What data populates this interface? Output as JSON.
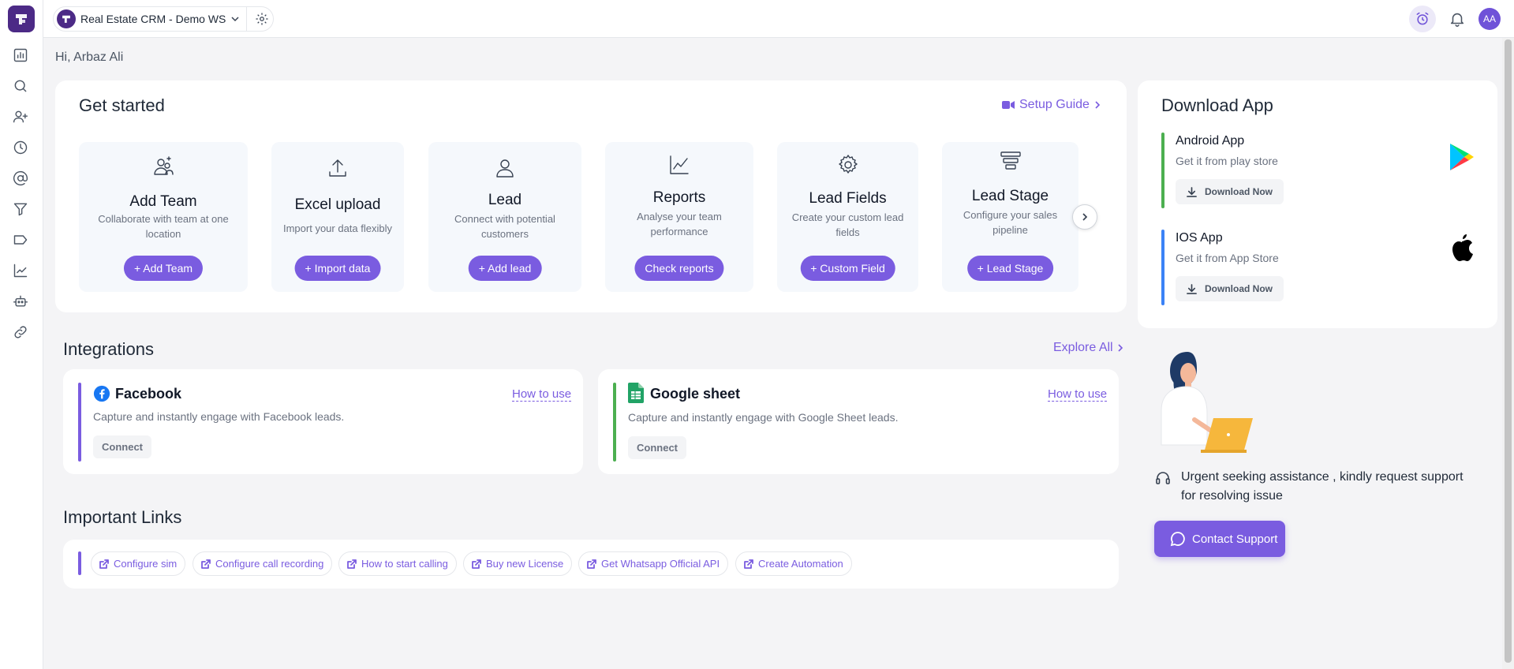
{
  "workspace": {
    "name": "Real Estate CRM - Demo WS"
  },
  "user": {
    "initials": "AA",
    "greeting": "Hi, Arbaz Ali"
  },
  "get_started": {
    "title": "Get started",
    "setup_guide": "Setup Guide",
    "tiles": [
      {
        "name": "Add Team",
        "desc": "Collaborate with team at one location",
        "button": "+ Add Team"
      },
      {
        "name": "Excel upload",
        "desc": "Import your data flexibly",
        "button": "+ Import data"
      },
      {
        "name": "Lead",
        "desc": "Connect with potential customers",
        "button": "+ Add lead"
      },
      {
        "name": "Reports",
        "desc": "Analyse your team performance",
        "button": "Check reports"
      },
      {
        "name": "Lead Fields",
        "desc": "Create your custom lead fields",
        "button": "+ Custom Field"
      },
      {
        "name": "Lead Stage",
        "desc": "Configure your sales pipeline",
        "button": "+ Lead Stage"
      }
    ]
  },
  "integrations": {
    "title": "Integrations",
    "explore_all": "Explore All",
    "items": [
      {
        "name": "Facebook",
        "how_to": "How to use",
        "desc": "Capture and instantly engage with Facebook leads.",
        "button": "Connect",
        "accent": "#7a5ce0"
      },
      {
        "name": "Google sheet",
        "how_to": "How to use",
        "desc": "Capture and instantly engage with Google Sheet leads.",
        "button": "Connect",
        "accent": "#4caf50"
      }
    ]
  },
  "important_links": {
    "title": "Important Links",
    "items": [
      "Configure sim",
      "Configure call recording",
      "How to start calling",
      "Buy new License",
      "Get Whatsapp Official API",
      "Create Automation"
    ]
  },
  "download_app": {
    "title": "Download App",
    "apps": [
      {
        "name": "Android App",
        "sub": "Get it from play store",
        "button": "Download Now",
        "accent": "#4caf50"
      },
      {
        "name": "IOS App",
        "sub": "Get it from App Store",
        "button": "Download Now",
        "accent": "#3b82f6"
      }
    ]
  },
  "support": {
    "text": "Urgent seeking assistance , kindly request support for resolving issue",
    "button": "Contact Support"
  },
  "colors": {
    "primary": "#7a5ce0",
    "brand_dark": "#4c2a86"
  }
}
